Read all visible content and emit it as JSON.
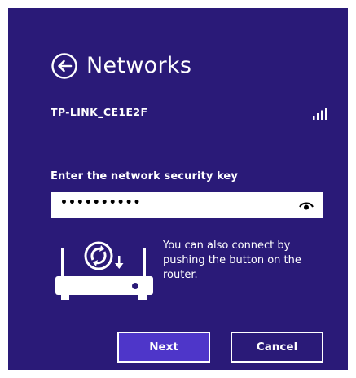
{
  "header": {
    "title": "Networks",
    "back_icon": "back-arrow-circle-icon"
  },
  "network": {
    "name": "TP-LINK_CE1E2F",
    "signal_icon": "wifi-signal-bars-icon"
  },
  "security": {
    "label": "Enter the network security key",
    "value": "••••••••••",
    "reveal_icon": "eye-icon"
  },
  "wps": {
    "text": "You can also connect by pushing the button on the router.",
    "icon": "router-wps-icon"
  },
  "buttons": {
    "next": "Next",
    "cancel": "Cancel"
  },
  "colors": {
    "background": "#2a1a78",
    "accent": "#4e36c9",
    "text": "#ffffff"
  }
}
